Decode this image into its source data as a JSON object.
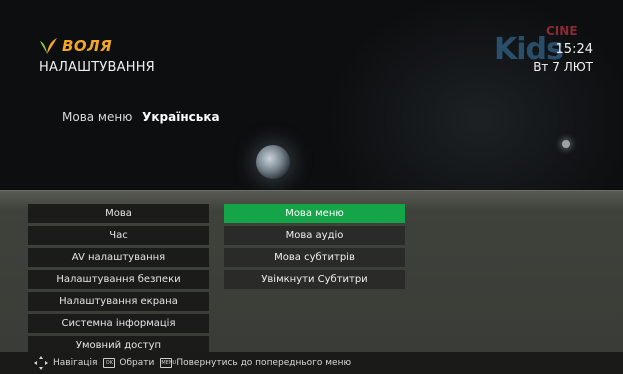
{
  "header": {
    "brand": "ВОЛЯ",
    "screen_title": "НАЛАШТУВАННЯ",
    "time": "15:24",
    "date": "Вт 7 ЛЮТ",
    "channel_logo": "Kids",
    "channel_logo_small": "CINE"
  },
  "current_setting": {
    "label": "Мова меню",
    "value": "Українська"
  },
  "menu_main": [
    "Мова",
    "Час",
    "AV налаштування",
    "Налаштування безпеки",
    "Налаштування екрана",
    "Системна інформація",
    "Умовний доступ"
  ],
  "menu_sub": [
    "Мова меню",
    "Мова аудіо",
    "Мова субтитрів",
    "Увімкнути Субтитри"
  ],
  "footer": {
    "navigation": "Навігація",
    "ok_key": "OK",
    "select": "Обрати",
    "back_key": "MENU",
    "back": "Повернутись до попереднього меню"
  },
  "colors": {
    "accent_green": "#13a548",
    "brand_orange": "#f5a623"
  },
  "icons": {
    "logo": "leaf-logo-icon",
    "navigation": "dpad-arrows-icon",
    "ok": "ok-key-icon",
    "back": "menu-key-icon"
  }
}
